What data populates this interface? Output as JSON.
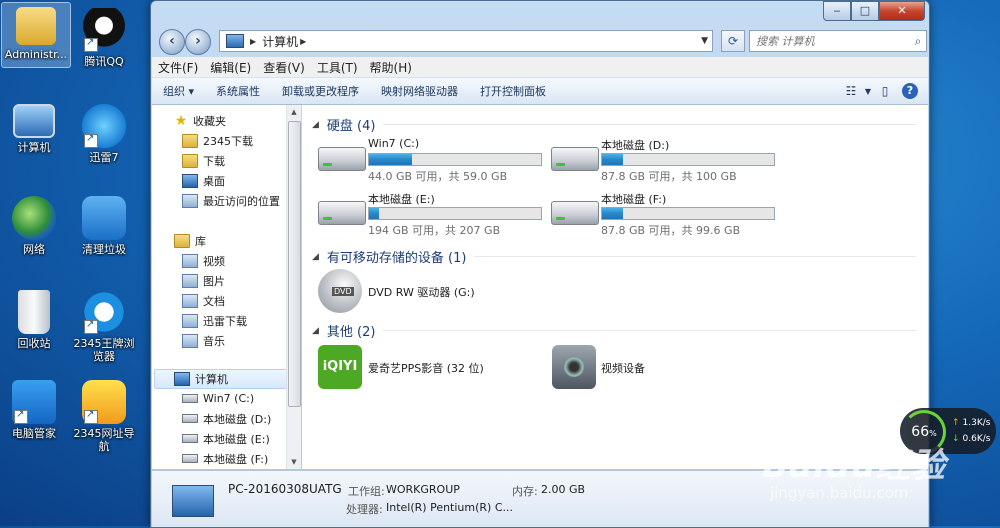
{
  "desktop": {
    "icons": [
      {
        "label": "Administr..."
      },
      {
        "label": "腾讯QQ"
      },
      {
        "label": "计算机"
      },
      {
        "label": "迅雷7"
      },
      {
        "label": "网络"
      },
      {
        "label": "清理垃圾"
      },
      {
        "label": "回收站"
      },
      {
        "label": "2345王牌浏览器"
      },
      {
        "label": "电脑管家"
      },
      {
        "label": "2345网址导航"
      }
    ]
  },
  "window": {
    "buttons": {
      "minimize": "‒",
      "maximize": "□",
      "close": "✕"
    },
    "address": {
      "crumb": "计算机"
    },
    "search": {
      "placeholder": "搜索 计算机"
    },
    "menu": [
      "文件(F)",
      "编辑(E)",
      "查看(V)",
      "工具(T)",
      "帮助(H)"
    ],
    "toolbar": [
      "组织 ▾",
      "系统属性",
      "卸载或更改程序",
      "映射网络驱动器",
      "打开控制面板"
    ],
    "nav": {
      "favorites": "收藏夹",
      "fav_items": [
        "2345下载",
        "下载",
        "桌面",
        "最近访问的位置"
      ],
      "libraries": "库",
      "lib_items": [
        "视频",
        "图片",
        "文档",
        "迅雷下载",
        "音乐"
      ],
      "computer": "计算机",
      "drives": [
        "Win7 (C:)",
        "本地磁盘 (D:)",
        "本地磁盘 (E:)",
        "本地磁盘 (F:)"
      ]
    },
    "groups": {
      "hdd": "硬盘 (4)",
      "removable": "有可移动存储的设备 (1)",
      "other": "其他 (2)"
    },
    "drives": [
      {
        "name": "Win7 (C:)",
        "space": "44.0 GB 可用，共 59.0 GB",
        "used_fraction": 0.25
      },
      {
        "name": "本地磁盘 (D:)",
        "space": "87.8 GB 可用，共 100 GB",
        "used_fraction": 0.12
      },
      {
        "name": "本地磁盘 (E:)",
        "space": "194 GB 可用，共 207 GB",
        "used_fraction": 0.06
      },
      {
        "name": "本地磁盘 (F:)",
        "space": "87.8 GB 可用，共 99.6 GB",
        "used_fraction": 0.12
      }
    ],
    "removable": {
      "name": "DVD RW 驱动器 (G:)",
      "badge": "DVD"
    },
    "other": [
      {
        "name": "爱奇艺PPS影音 (32 位)",
        "badge": "iQIYI"
      },
      {
        "name": "视频设备"
      }
    ],
    "details": {
      "pc_name": "PC-20160308UATG",
      "workgroup_label": "工作组:",
      "workgroup": "WORKGROUP",
      "memory_label": "内存:",
      "memory": "2.00 GB",
      "cpu_label": "处理器:",
      "cpu": "Intel(R) Pentium(R) C..."
    }
  },
  "network_gauge": {
    "percent": "66",
    "percent_unit": "%",
    "up": "1.3K/s",
    "down": "0.6K/s"
  },
  "watermark": {
    "main": "Baidu经验",
    "sub": "jingyan.baidu.com"
  }
}
